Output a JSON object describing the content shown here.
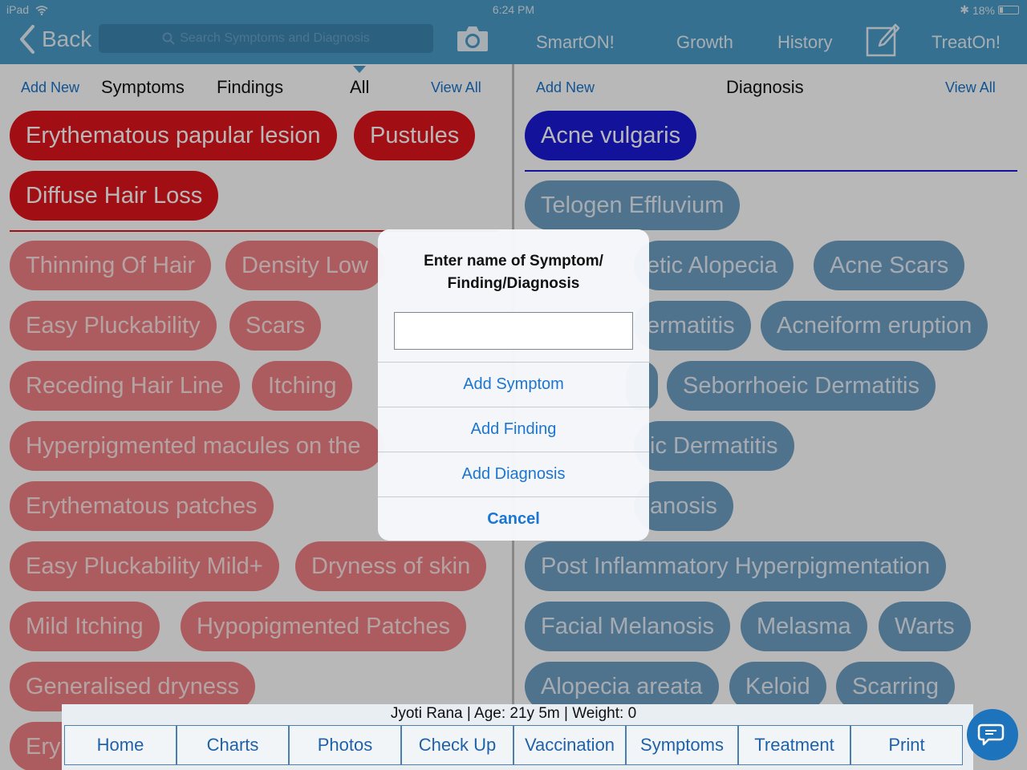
{
  "status_bar": {
    "device": "iPad",
    "time": "6:24 PM",
    "battery": "18%",
    "battery_level": 0.18
  },
  "header": {
    "back_label": "Back",
    "search_placeholder": "Search Symptoms and Diagnosis",
    "nav": [
      "SmartON!",
      "Growth",
      "History",
      "TreatOn!"
    ]
  },
  "left_pane": {
    "add_new": "Add New",
    "tabs": [
      "Symptoms",
      "Findings",
      "All"
    ],
    "active_tab": "All",
    "view_all": "View All",
    "selected": [
      "Erythematous papular lesion",
      "Pustules",
      "Diffuse Hair Loss"
    ],
    "suggestions": [
      "Thinning Of Hair",
      "Density Low",
      "Easy Pluckability",
      "Scars",
      "Receding Hair Line",
      "Itching",
      "Hyperpigmented macules on the",
      "Erythematous patches",
      "Easy Pluckability Mild+",
      "Dryness of skin",
      "Mild Itching",
      "Hypopigmented Patches",
      "Generalised dryness",
      "Ery"
    ]
  },
  "right_pane": {
    "add_new": "Add New",
    "title": "Diagnosis",
    "view_all": "View All",
    "selected": [
      "Acne vulgaris"
    ],
    "suggestions": [
      "Telogen Effluvium",
      "etic Alopecia",
      "Acne Scars",
      "ermatitis",
      "Acneiform eruption",
      "Seborrhoeic Dermatitis",
      "ic Dermatitis",
      "anosis",
      "Post Inflammatory Hyperpigmentation",
      "Facial Melanosis",
      "Melasma",
      "Warts",
      "Alopecia areata",
      "Keloid",
      "Scarring"
    ]
  },
  "dialog": {
    "title_line1": "Enter name of Symptom/",
    "title_line2": "Finding/Diagnosis",
    "input_value": "",
    "buttons": [
      "Add Symptom",
      "Add Finding",
      "Add Diagnosis",
      "Cancel"
    ]
  },
  "patient_info": "Jyoti Rana | Age: 21y 5m | Weight: 0",
  "bottom_nav": [
    "Home",
    "Charts",
    "Photos",
    "Check Up",
    "Vaccination",
    "Symptoms",
    "Treatment",
    "Print"
  ],
  "colors": {
    "header": "#4a9bc8",
    "selected_symptom": "#e0151c",
    "symptom": "#ef8083",
    "selected_diagnosis": "#1a1ad6",
    "diagnosis": "#6e9fc4",
    "link": "#1a73c9"
  }
}
